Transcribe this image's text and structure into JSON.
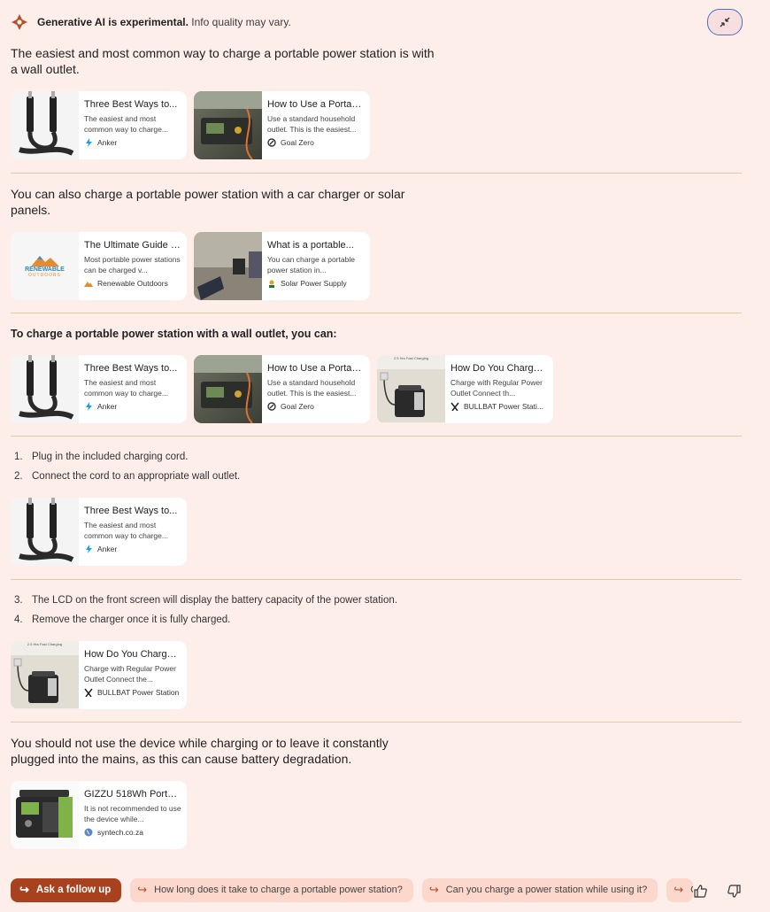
{
  "header": {
    "bold": "Generative AI is experimental.",
    "rest": " Info quality may vary."
  },
  "sections": {
    "s1": {
      "text": "The easiest and most common way to charge a portable power station is with a wall outlet."
    },
    "s2": {
      "text": "You can also charge a portable power station with a car charger or solar panels."
    },
    "s3": {
      "text": "To charge a portable power station with a wall outlet, you can:"
    },
    "s4": {
      "items": [
        "1.",
        "Plug in the included charging cord.",
        "2.",
        "Connect the cord to an appropriate wall outlet."
      ]
    },
    "s5": {
      "items": [
        "3.",
        "The LCD on the front screen will display the battery capacity of the power station.",
        "4.",
        "Remove the charger once it is fully charged."
      ]
    },
    "s6": {
      "text": "You should not use the device while charging or to leave it constantly plugged into the mains, as this can cause battery degradation."
    }
  },
  "cards": {
    "anker": {
      "title": "Three Best Ways to...",
      "desc": "The easiest and most common way to charge...",
      "source": "Anker"
    },
    "goalzero": {
      "title": "How to Use a Portabl...",
      "desc": "Use a standard household outlet. This is the easiest...",
      "source": "Goal Zero"
    },
    "renewable": {
      "title": "The Ultimate Guide t...",
      "desc": "Most portable power stations can be charged v...",
      "source": "Renewable Outdoors",
      "logo_text": "RENEWABLE",
      "logo_sub": "OUTDOORS"
    },
    "solar": {
      "title": "What is a portable...",
      "desc": "You can charge a portable power station in...",
      "source": "Solar Power Supply"
    },
    "bullbat_a": {
      "title": "How Do You Charge ...",
      "desc": "Charge with Regular Power Outlet Connect th...",
      "source": "BULLBAT Power Stati..."
    },
    "bullbat_b": {
      "title": "How Do You Charge ...",
      "desc": "Charge with Regular Power Outlet Connect the...",
      "source": "BULLBAT Power Station"
    },
    "gizzu": {
      "title": "GIZZU 518Wh Portabl...",
      "desc": "It is not recommended to use the device while...",
      "source": "syntech.co.za"
    },
    "bullbat_thumb_caption": "2.5 Hrs Fast Charging"
  },
  "bottom": {
    "ask": "Ask a follow up",
    "chips": [
      "How long does it take to charge a portable power station?",
      "Can you charge a power station while using it?",
      "Ca"
    ]
  },
  "colors": {
    "background": "#fdeee9",
    "accent": "#a8421e",
    "chip": "#fbd7cc",
    "divider": "#e8c9a8"
  },
  "icons": [
    "sparkle-logo-icon",
    "collapse-icon",
    "bolt-icon",
    "goal-zero-icon",
    "sun-icon",
    "bullbat-icon",
    "globe-icon",
    "reply-arrow-icon",
    "thumbs-up-icon",
    "thumbs-down-icon"
  ]
}
